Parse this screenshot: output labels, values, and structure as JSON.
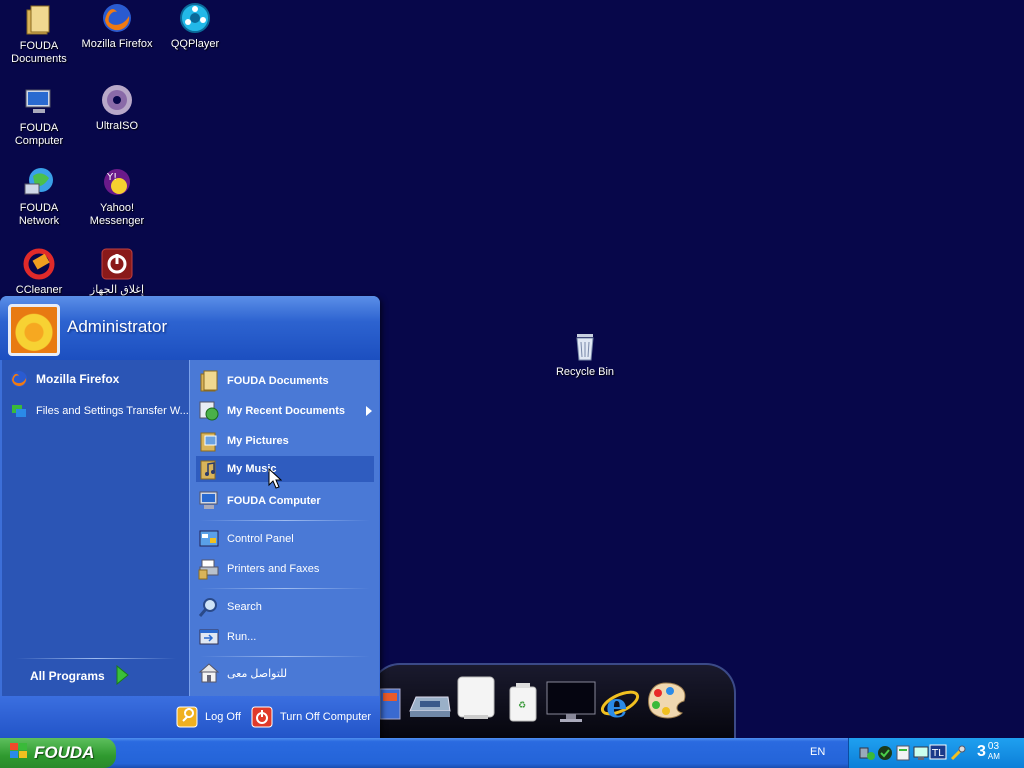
{
  "desktop": {
    "icons": [
      {
        "label": "FOUDA Documents",
        "icon": "folder-icon"
      },
      {
        "label": "Mozilla Firefox",
        "icon": "firefox-icon"
      },
      {
        "label": "QQPlayer",
        "icon": "qqplayer-icon"
      },
      {
        "label": "FOUDA Computer",
        "icon": "computer-icon"
      },
      {
        "label": "UltraISO",
        "icon": "disc-icon"
      },
      {
        "label": "FOUDA Network",
        "icon": "network-icon"
      },
      {
        "label": "Yahoo! Messenger",
        "icon": "yahoo-icon"
      },
      {
        "label": "CCleaner",
        "icon": "ccleaner-icon"
      },
      {
        "label": "إغلاق الجهاز",
        "icon": "power-icon"
      },
      {
        "label": "Recycle Bin",
        "icon": "recycle-bin-icon"
      }
    ]
  },
  "start_menu": {
    "user_name": "Administrator",
    "pinned": [
      {
        "label": "Mozilla Firefox"
      },
      {
        "label": "Files and Settings Transfer W..."
      }
    ],
    "all_programs": "All Programs",
    "right_items": [
      {
        "label": "FOUDA Documents"
      },
      {
        "label": "My Recent Documents"
      },
      {
        "label": "My Pictures"
      },
      {
        "label": "My Music"
      },
      {
        "label": "FOUDA Computer"
      },
      {
        "label": "Control Panel"
      },
      {
        "label": "Printers and Faxes"
      },
      {
        "label": "Search"
      },
      {
        "label": "Run..."
      },
      {
        "label": "للتواصل معى"
      }
    ],
    "log_off": "Log Off",
    "turn_off": "Turn Off Computer"
  },
  "taskbar": {
    "start_label": "FOUDA",
    "language": "EN",
    "clock_hour": "3",
    "clock_min": "03",
    "clock_ampm": "AM"
  }
}
